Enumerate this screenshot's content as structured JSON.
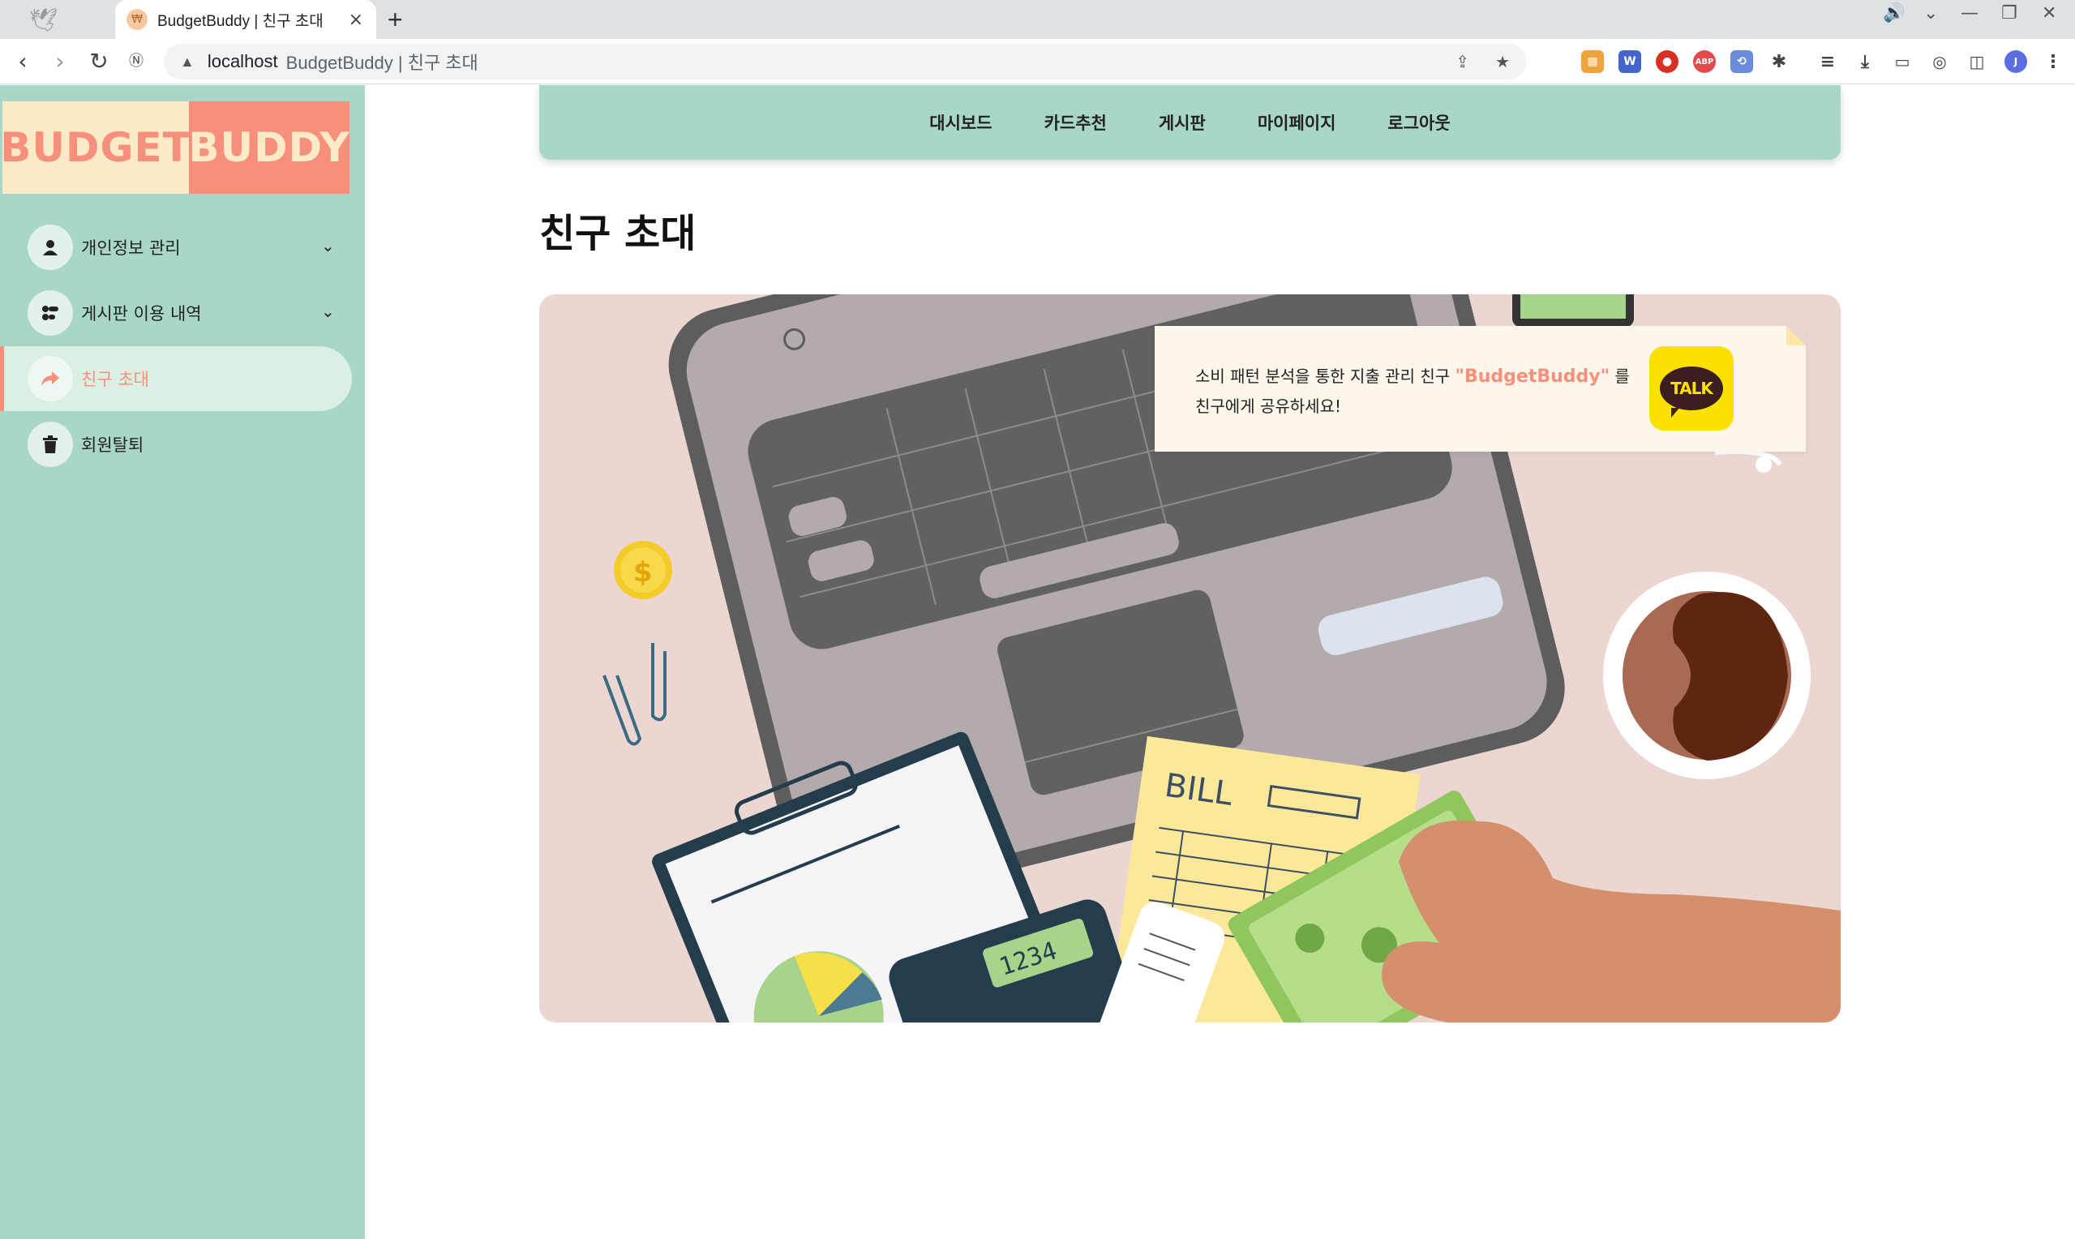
{
  "browser": {
    "tab_title": "BudgetBuddy | 친구 초대",
    "url_host": "localhost",
    "url_title": "BudgetBuddy | 친구 초대",
    "new_tab_label": "+"
  },
  "logo": {
    "left": "BUDGET",
    "right": "BUDDY"
  },
  "sidebar": {
    "items": [
      {
        "label": "개인정보 관리",
        "icon": "user-icon",
        "expandable": true
      },
      {
        "label": "게시판 이용 내역",
        "icon": "board-icon",
        "expandable": true
      },
      {
        "label": "친구 초대",
        "icon": "share-icon",
        "active": true
      },
      {
        "label": "회원탈퇴",
        "icon": "trash-icon"
      }
    ]
  },
  "topnav": {
    "items": [
      "대시보드",
      "카드추천",
      "게시판",
      "마이페이지",
      "로그아웃"
    ]
  },
  "page": {
    "title": "친구 초대"
  },
  "invite": {
    "text_before": "소비 패턴 분석을 통한 지출 관리 친구 ",
    "highlight": "\"BudgetBuddy\"",
    "text_after": " 를 친구에게 공유하세요!",
    "talk_label": "TALK"
  },
  "colors": {
    "mint": "#a9d7c7",
    "coral": "#f6907c",
    "cream": "#fdebc8",
    "kakao": "#fae100"
  }
}
